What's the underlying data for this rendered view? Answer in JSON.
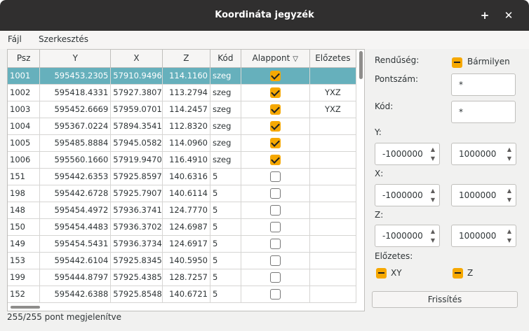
{
  "window": {
    "title": "Koordináta jegyzék"
  },
  "titlebar": {
    "plus_icon": "+",
    "close_icon": "✕"
  },
  "menubar": {
    "file": "Fájl",
    "edit": "Szerkesztés"
  },
  "table": {
    "columns": [
      "Psz",
      "Y",
      "X",
      "Z",
      "Kód",
      "Alappont",
      "Előzetes"
    ],
    "rows": [
      {
        "psz": "1001",
        "y": "595453.2305",
        "x": "57910.9496",
        "z": "114.1160",
        "kod": "szeg",
        "alappont": true,
        "elozetes": "",
        "selected": true
      },
      {
        "psz": "1002",
        "y": "595418.4331",
        "x": "57927.3807",
        "z": "113.2794",
        "kod": "szeg",
        "alappont": true,
        "elozetes": "YXZ"
      },
      {
        "psz": "1003",
        "y": "595452.6669",
        "x": "57959.0701",
        "z": "114.2457",
        "kod": "szeg",
        "alappont": true,
        "elozetes": "YXZ"
      },
      {
        "psz": "1004",
        "y": "595367.0224",
        "x": "57894.3541",
        "z": "112.8320",
        "kod": "szeg",
        "alappont": true,
        "elozetes": ""
      },
      {
        "psz": "1005",
        "y": "595485.8884",
        "x": "57945.0582",
        "z": "114.0960",
        "kod": "szeg",
        "alappont": true,
        "elozetes": ""
      },
      {
        "psz": "1006",
        "y": "595560.1660",
        "x": "57919.9470",
        "z": "116.4910",
        "kod": "szeg",
        "alappont": true,
        "elozetes": ""
      },
      {
        "psz": "151",
        "y": "595442.6353",
        "x": "57925.8597",
        "z": "140.6316",
        "kod": "5",
        "alappont": false,
        "elozetes": ""
      },
      {
        "psz": "198",
        "y": "595442.6728",
        "x": "57925.7907",
        "z": "140.6114",
        "kod": "5",
        "alappont": false,
        "elozetes": ""
      },
      {
        "psz": "148",
        "y": "595454.4972",
        "x": "57936.3741",
        "z": "124.7770",
        "kod": "5",
        "alappont": false,
        "elozetes": ""
      },
      {
        "psz": "150",
        "y": "595454.4483",
        "x": "57936.3702",
        "z": "124.6987",
        "kod": "5",
        "alappont": false,
        "elozetes": ""
      },
      {
        "psz": "149",
        "y": "595454.5431",
        "x": "57936.3734",
        "z": "124.6917",
        "kod": "5",
        "alappont": false,
        "elozetes": ""
      },
      {
        "psz": "153",
        "y": "595442.6104",
        "x": "57925.8345",
        "z": "140.5950",
        "kod": "5",
        "alappont": false,
        "elozetes": ""
      },
      {
        "psz": "199",
        "y": "595444.8797",
        "x": "57925.4385",
        "z": "128.7257",
        "kod": "5",
        "alappont": false,
        "elozetes": ""
      },
      {
        "psz": "152",
        "y": "595442.6388",
        "x": "57925.8548",
        "z": "140.6721",
        "kod": "5",
        "alappont": false,
        "elozetes": ""
      }
    ]
  },
  "status": {
    "text": "255/255 pont megjelenítve"
  },
  "filter": {
    "order_label": "Rendűség:",
    "order_value": "Bármilyen",
    "number_label": "Pontszám:",
    "number_value": "*",
    "code_label": "Kód:",
    "code_value": "*",
    "y_label": "Y:",
    "y_min": "-1000000",
    "y_max": "1000000",
    "x_label": "X:",
    "x_min": "-1000000",
    "x_max": "1000000",
    "z_label": "Z:",
    "z_min": "-1000000",
    "z_max": "1000000",
    "prelim_label": "Előzetes:",
    "prelim_xy": "XY",
    "prelim_z": "Z",
    "refresh": "Frissítés"
  },
  "colors": {
    "selection": "#66b0bc",
    "accent": "#f6a800",
    "titlebar": "#302f2f"
  }
}
